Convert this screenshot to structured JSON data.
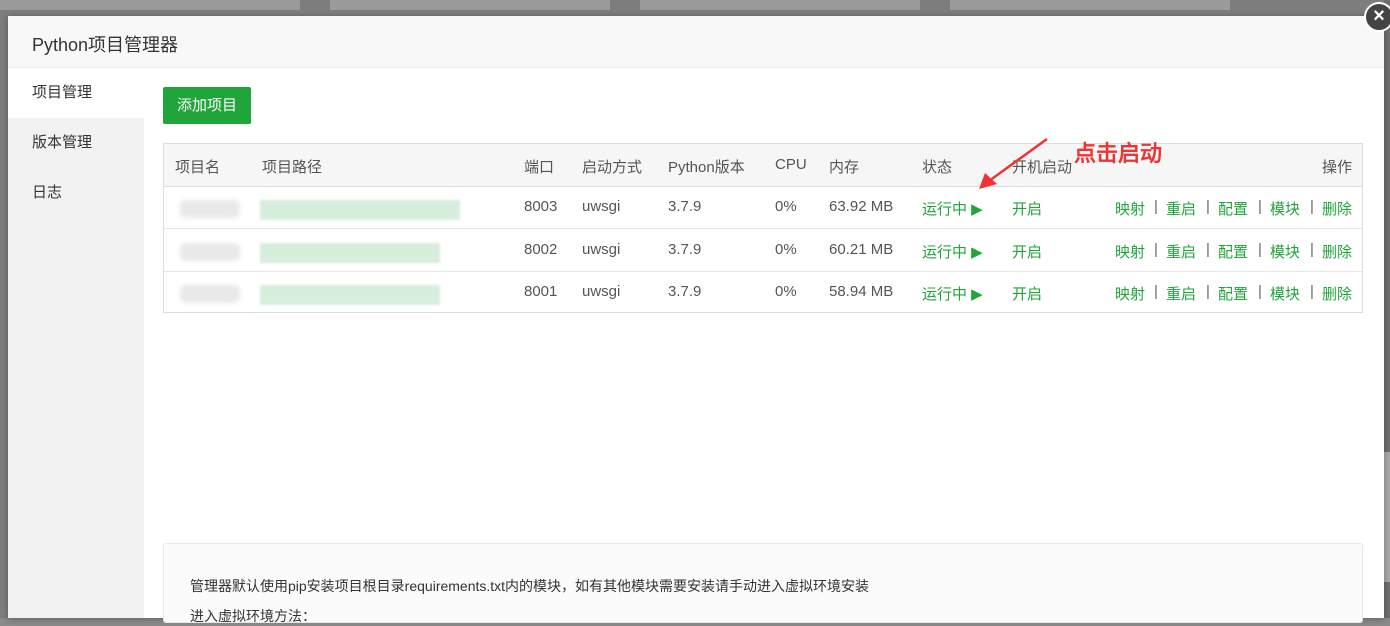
{
  "modal": {
    "title": "Python项目管理器",
    "close_label": "×"
  },
  "sidebar": {
    "items": [
      {
        "label": "项目管理",
        "active": true
      },
      {
        "label": "版本管理",
        "active": false
      },
      {
        "label": "日志",
        "active": false
      }
    ]
  },
  "toolbar": {
    "add_label": "添加项目"
  },
  "table": {
    "headers": [
      "项目名",
      "项目路径",
      "端口",
      "启动方式",
      "Python版本",
      "CPU",
      "内存",
      "状态",
      "开机启动",
      "操作"
    ],
    "rows": [
      {
        "port": "8003",
        "mode": "uwsgi",
        "python": "3.7.9",
        "cpu": "0%",
        "mem": "63.92 MB",
        "status": "运行中 ▶",
        "autostart": "开启"
      },
      {
        "port": "8002",
        "mode": "uwsgi",
        "python": "3.7.9",
        "cpu": "0%",
        "mem": "60.21 MB",
        "status": "运行中 ▶",
        "autostart": "开启"
      },
      {
        "port": "8001",
        "mode": "uwsgi",
        "python": "3.7.9",
        "cpu": "0%",
        "mem": "58.94 MB",
        "status": "运行中 ▶",
        "autostart": "开启"
      }
    ],
    "actions": [
      "映射",
      "重启",
      "配置",
      "模块",
      "删除"
    ],
    "action_separator": "|"
  },
  "annotation": {
    "text": "点击启动",
    "color": "#ee3333"
  },
  "info": {
    "line1": "管理器默认使用pip安装项目根目录requirements.txt内的模块，如有其他模块需要安装请手动进入虚拟环境安装",
    "line2": "进入虚拟环境方法："
  },
  "colors": {
    "accent": "#20a53a",
    "annotation": "#ee3333"
  }
}
